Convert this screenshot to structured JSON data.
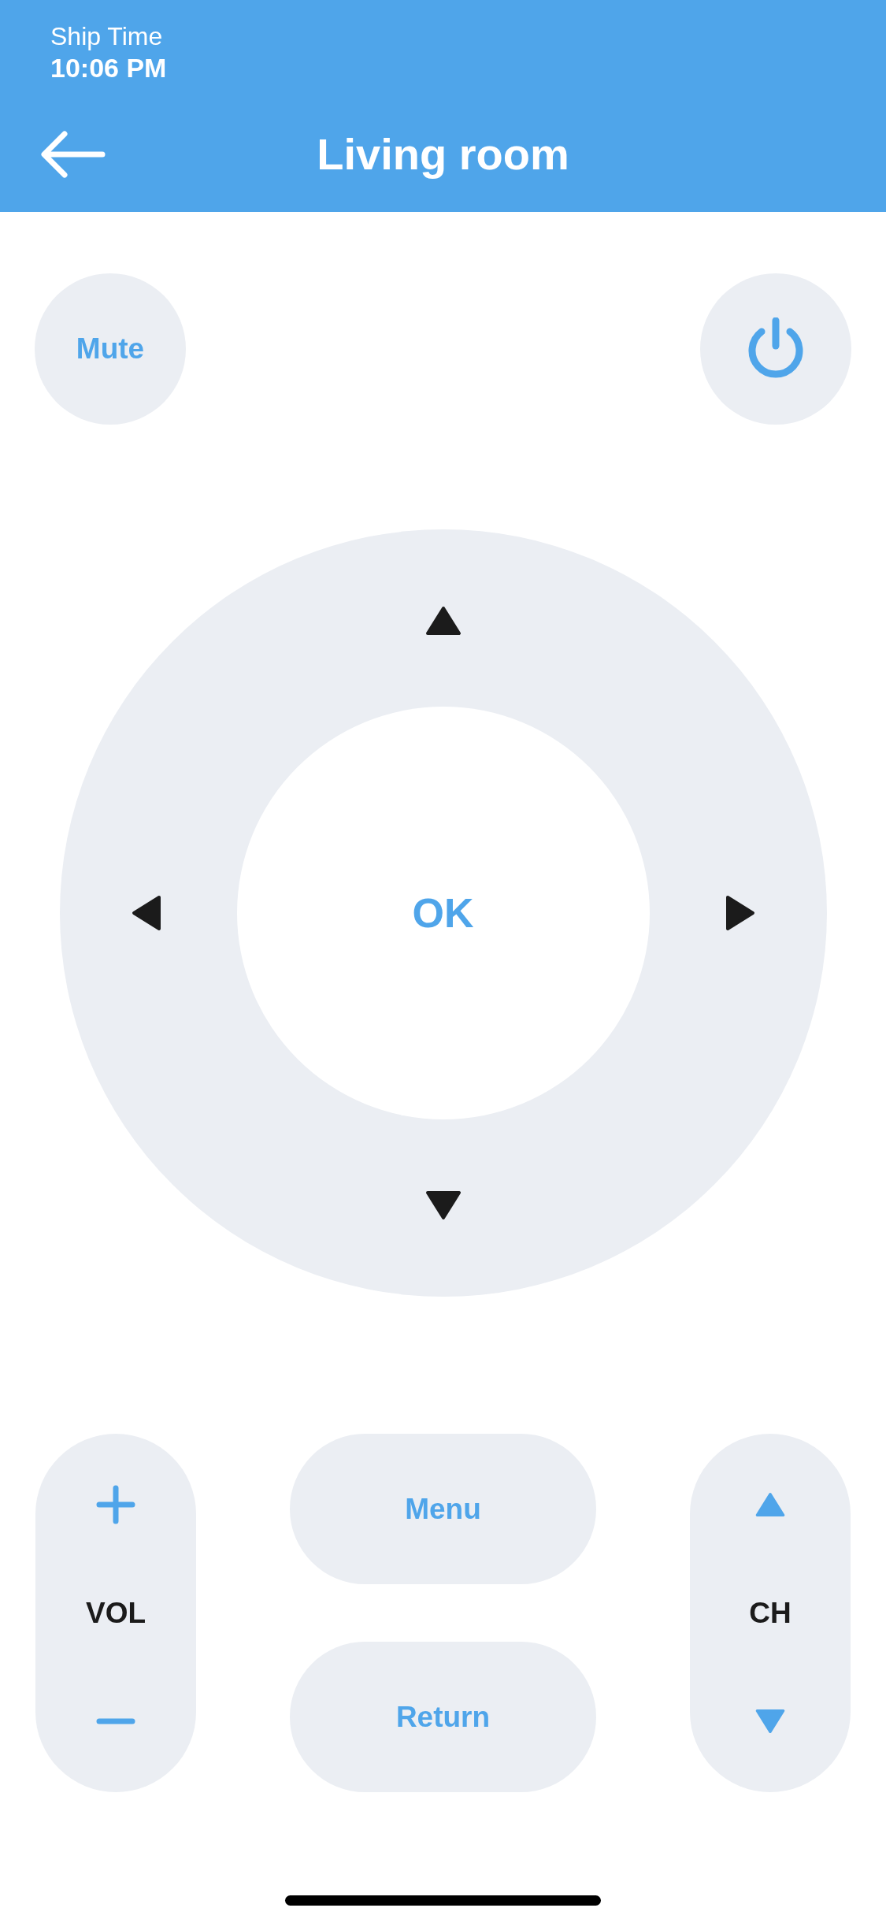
{
  "status": {
    "label": "Ship Time",
    "time": "10:06 PM"
  },
  "header": {
    "title": "Living room"
  },
  "mute": {
    "label": "Mute"
  },
  "dpad": {
    "center_label": "OK"
  },
  "volume": {
    "label": "VOL"
  },
  "center_buttons": [
    "Menu",
    "Return"
  ],
  "channel": {
    "label": "CH"
  }
}
